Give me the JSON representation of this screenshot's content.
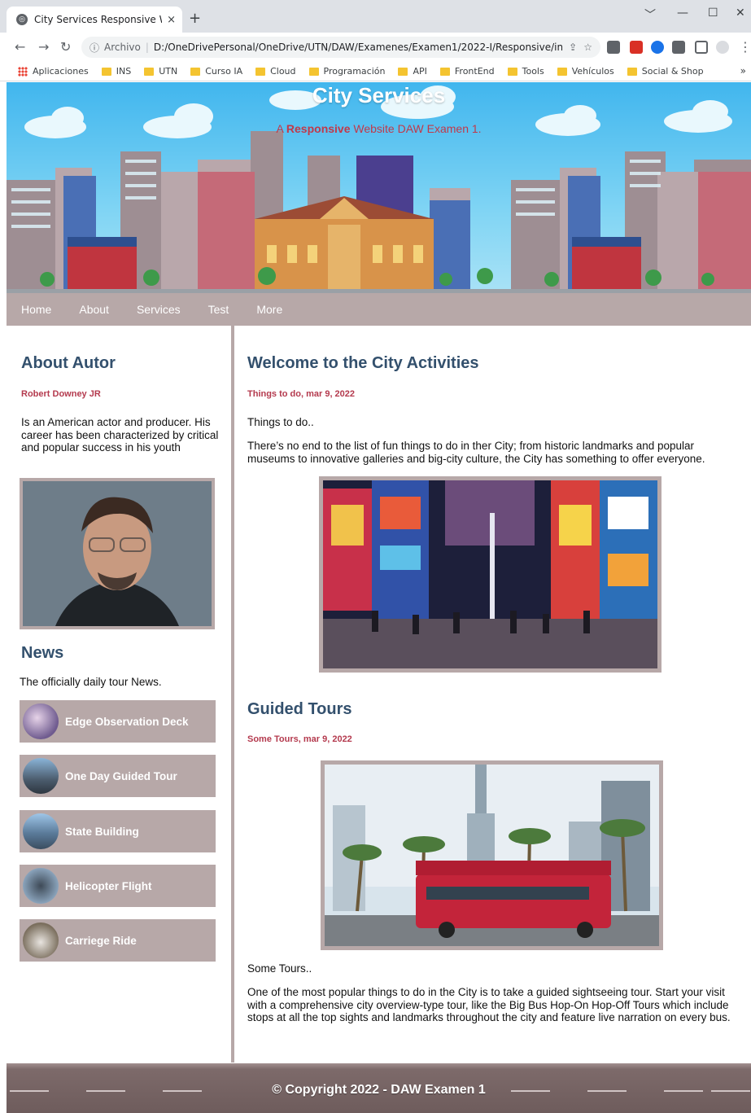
{
  "browser": {
    "tab_title": "City Services Responsive Website",
    "tab_close": "×",
    "new_tab": "+",
    "window_controls": [
      "﹀",
      "—",
      "☐",
      "✕"
    ],
    "address": {
      "scheme_label": "Archivo",
      "separator": "|",
      "url": "D:/OneDrivePersonal/OneDrive/UTN/DAW/Examenes/Examen1/2022-I/Responsive/index.h..."
    },
    "bookmarks": [
      "Aplicaciones",
      "INS",
      "UTN",
      "Curso IA",
      "Cloud",
      "Programación",
      "API",
      "FrontEnd",
      "Tools",
      "Vehículos",
      "Social & Shop"
    ],
    "bookmarks_more": "»",
    "icons": [
      "back-arrow-icon",
      "forward-arrow-icon",
      "reload-icon",
      "info-icon",
      "share-icon",
      "star-icon",
      "extensions-icon",
      "profile-icon"
    ]
  },
  "header": {
    "title": "City Services",
    "subtitle_prefix": "A ",
    "subtitle_bold": "Responsive",
    "subtitle_suffix": " Website DAW Examen 1."
  },
  "nav": {
    "items": [
      "Home",
      "About",
      "Services",
      "Test",
      "More"
    ]
  },
  "sidebar": {
    "about_heading": "About Autor",
    "author_name": "Robert Downey JR",
    "author_bio": "Is an American actor and producer. His career has been characterized by critical and popular success in his youth",
    "news_heading": "News",
    "news_intro": "The officially daily tour News.",
    "news_items": [
      {
        "label": "Edge Observation Deck"
      },
      {
        "label": "One Day Guided Tour"
      },
      {
        "label": "State Building"
      },
      {
        "label": "Helicopter Flight"
      },
      {
        "label": "Carriege Ride"
      }
    ]
  },
  "main": {
    "section1": {
      "heading": "Welcome to the City Activities",
      "byline": "Things to do, mar 9, 2022",
      "lead": "Things to do..",
      "body": "There’s no end to the list of fun things to do in ther City; from historic landmarks and popular museums to innovative galleries and big-city culture, the City has something to offer everyone."
    },
    "section2": {
      "heading": "Guided Tours",
      "byline": "Some Tours, mar 9, 2022",
      "lead": "Some Tours..",
      "body": "One of the most popular things to do in the City is to take a guided sightseeing tour. Start your visit with a comprehensive city overview-type tour, like the Big Bus Hop-On Hop-Off Tours which include stops at all the top sights and landmarks throughout the city and feature live narration on every bus."
    }
  },
  "footer": {
    "copyright": "© Copyright 2022 - DAW Examen 1"
  },
  "colors": {
    "accent_mauve": "#b7a8a8",
    "heading_blue": "#33506d",
    "byline_red": "#b43a4e",
    "footer_brown": "#6e5c5c"
  }
}
